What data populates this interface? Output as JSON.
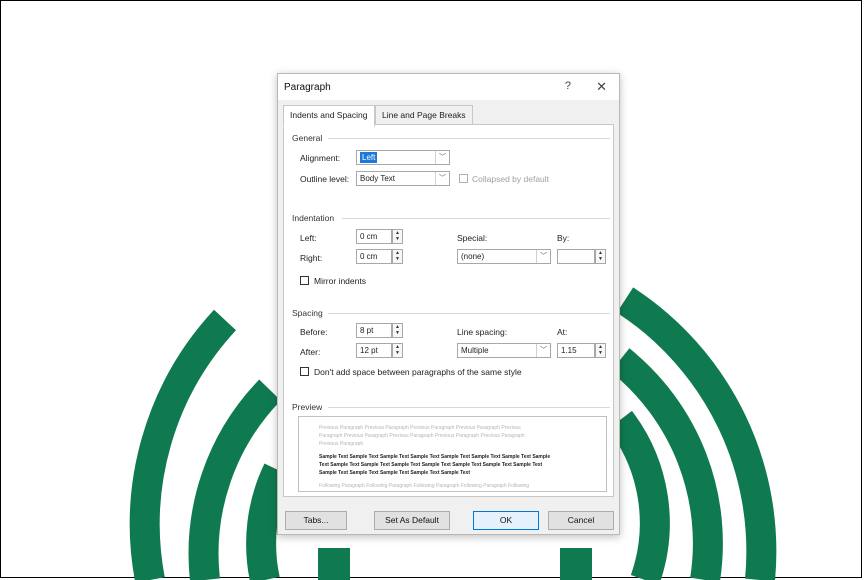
{
  "dialog": {
    "title": "Paragraph",
    "help": "?",
    "close": "✕",
    "tabs": [
      {
        "label": "Indents and Spacing",
        "active": true
      },
      {
        "label": "Line and Page Breaks",
        "active": false
      }
    ]
  },
  "general": {
    "heading": "General",
    "alignment_label": "Alignment:",
    "alignment_value": "Left",
    "outline_label": "Outline level:",
    "outline_value": "Body Text",
    "collapsed_label": "Collapsed by default"
  },
  "indentation": {
    "heading": "Indentation",
    "left_label": "Left:",
    "left_value": "0 cm",
    "right_label": "Right:",
    "right_value": "0 cm",
    "special_label": "Special:",
    "special_value": "(none)",
    "by_label": "By:",
    "by_value": "",
    "mirror_label": "Mirror indents"
  },
  "spacing": {
    "heading": "Spacing",
    "before_label": "Before:",
    "before_value": "8 pt",
    "after_label": "After:",
    "after_value": "12 pt",
    "line_spacing_label": "Line spacing:",
    "line_spacing_value": "Multiple",
    "at_label": "At:",
    "at_value": "1.15",
    "dont_add_label": "Don't add space between paragraphs of the same style"
  },
  "preview": {
    "heading": "Preview",
    "previous_lines": [
      "Previous Paragraph Previous Paragraph Previous Paragraph Previous Paragraph Previous",
      "Paragraph Previous Paragraph Previous Paragraph Previous Paragraph Previous Paragraph",
      "Previous Paragraph"
    ],
    "sample_lines": [
      "Sample Text Sample Text Sample Text Sample Text Sample Text Sample Text Sample Text Sample",
      "Text Sample Text Sample Text Sample Text Sample Text Sample Text Sample Text Sample Text",
      "Sample Text Sample Text Sample Text Sample Text Sample Text"
    ],
    "following_line": "Following Paragraph Following Paragraph Following Paragraph Following Paragraph Following"
  },
  "buttons": {
    "tabs": "Tabs...",
    "set_default": "Set As Default",
    "ok": "OK",
    "cancel": "Cancel"
  },
  "colors": {
    "background_logo": "#0f7a4f",
    "selection": "#1e78d7"
  },
  "icons": {
    "dropdown": "chevron-down-icon",
    "spinner": "spin-up-down-icon"
  }
}
